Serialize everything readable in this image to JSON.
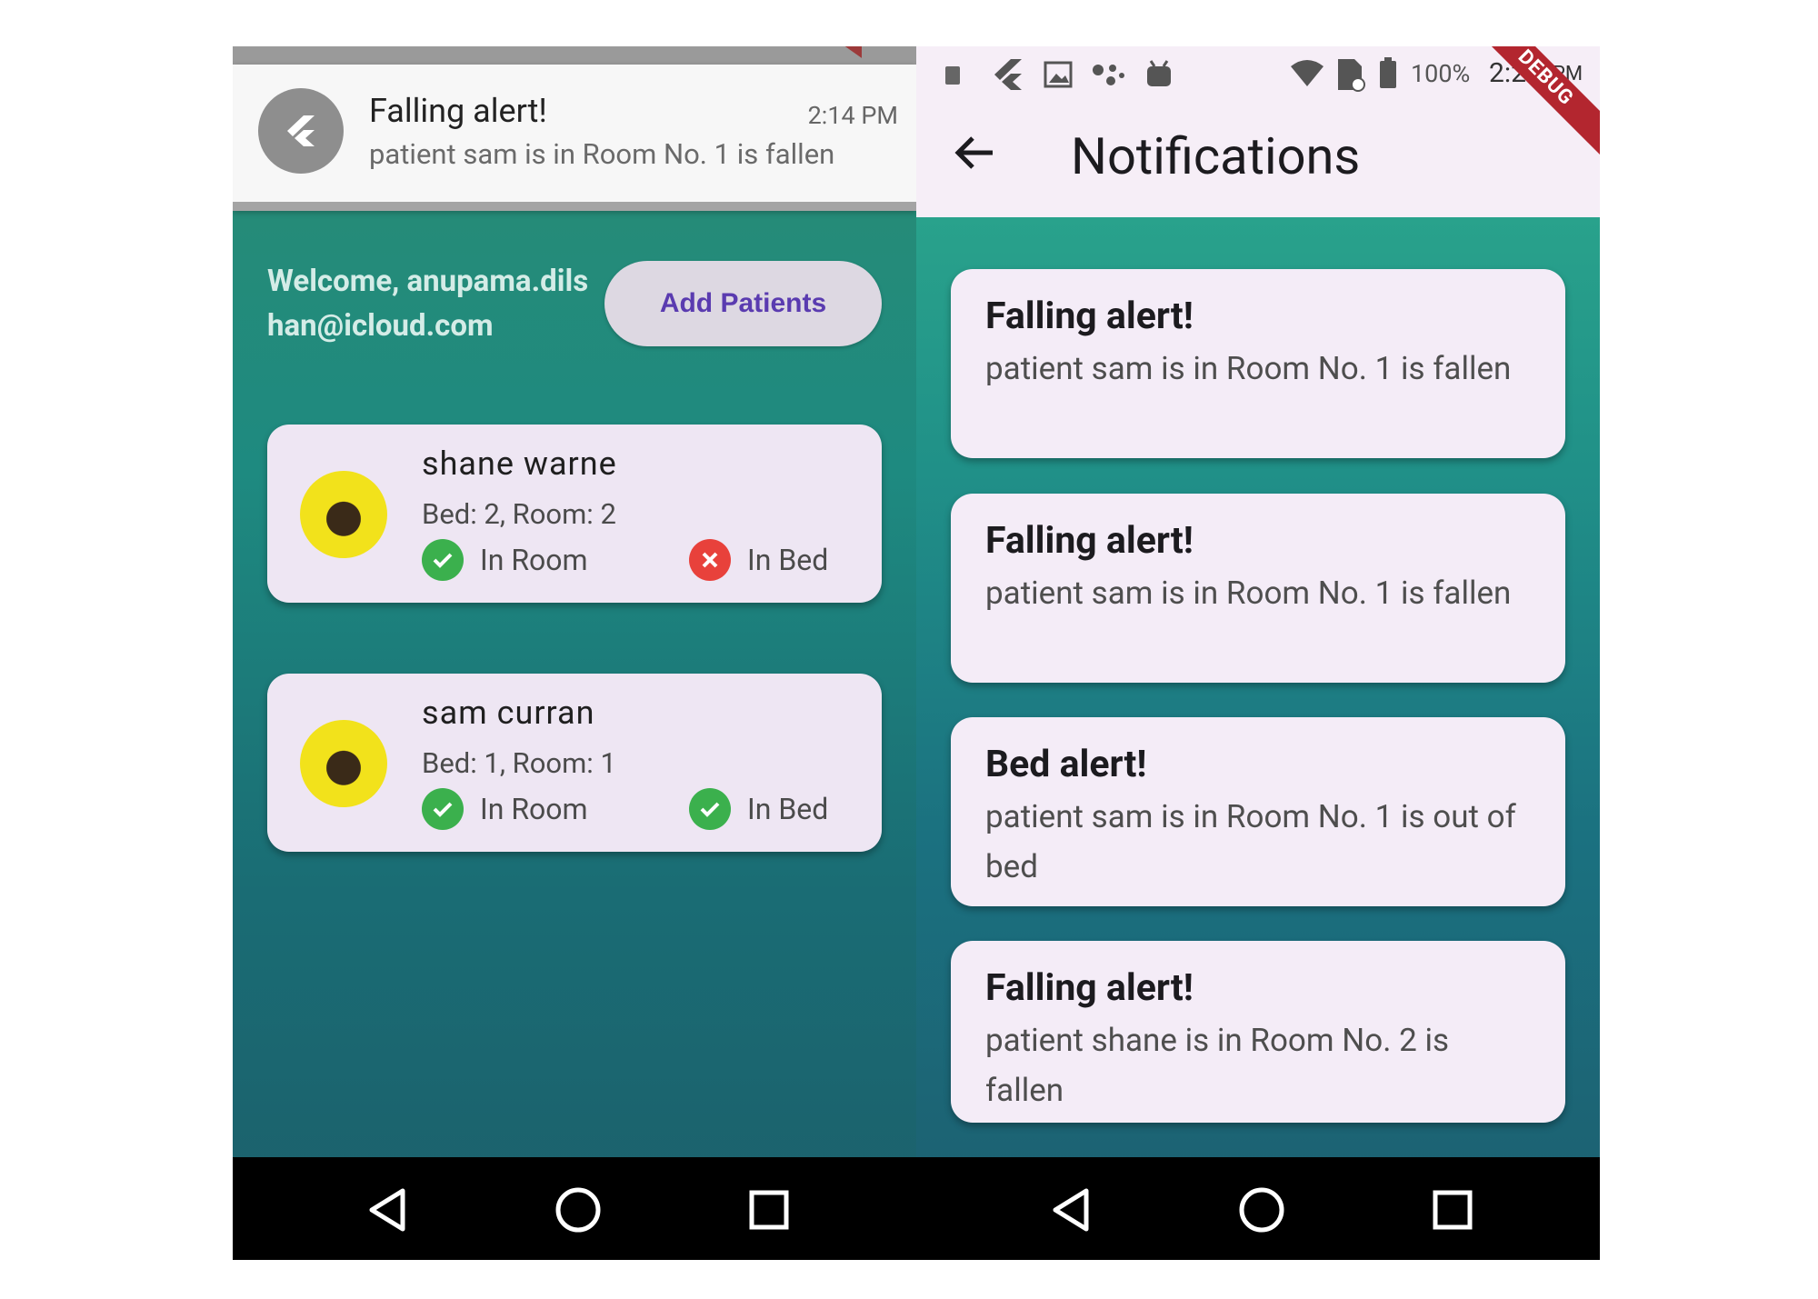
{
  "left_screen": {
    "heads_up": {
      "title": "Falling alert!",
      "time": "2:14 PM",
      "body": "patient sam is in Room No. 1 is fallen",
      "icon": "flutter-icon"
    },
    "welcome_text": "Welcome, anupama.dilshan@icloud.com",
    "add_patients_label": "Add Patients",
    "patients": [
      {
        "name": "shane warne",
        "info": "Bed: 2, Room: 2",
        "in_room_label": "In Room",
        "in_room": true,
        "in_bed_label": "In Bed",
        "in_bed": false
      },
      {
        "name": "sam curran",
        "info": "Bed: 1, Room: 1",
        "in_room_label": "In Room",
        "in_room": true,
        "in_bed_label": "In Bed",
        "in_bed": true
      }
    ]
  },
  "right_screen": {
    "status_bar": {
      "battery": "100%",
      "time": "2:25",
      "ampm": "PM"
    },
    "title": "Notifications",
    "debug_banner": "DEBUG",
    "notifications": [
      {
        "title": "Falling alert!",
        "body": "patient sam is in Room No. 1 is fallen"
      },
      {
        "title": "Falling alert!",
        "body": "patient sam is in Room No. 1 is fallen"
      },
      {
        "title": "Bed alert!",
        "body": "patient sam is in Room No. 1 is out of bed"
      },
      {
        "title": "Falling alert!",
        "body": "patient shane is in Room No. 2 is fallen"
      }
    ]
  },
  "colors": {
    "accent": "#5a3bb0",
    "ok": "#3bb04d",
    "error": "#e8413b",
    "card": "#eee6f3"
  }
}
